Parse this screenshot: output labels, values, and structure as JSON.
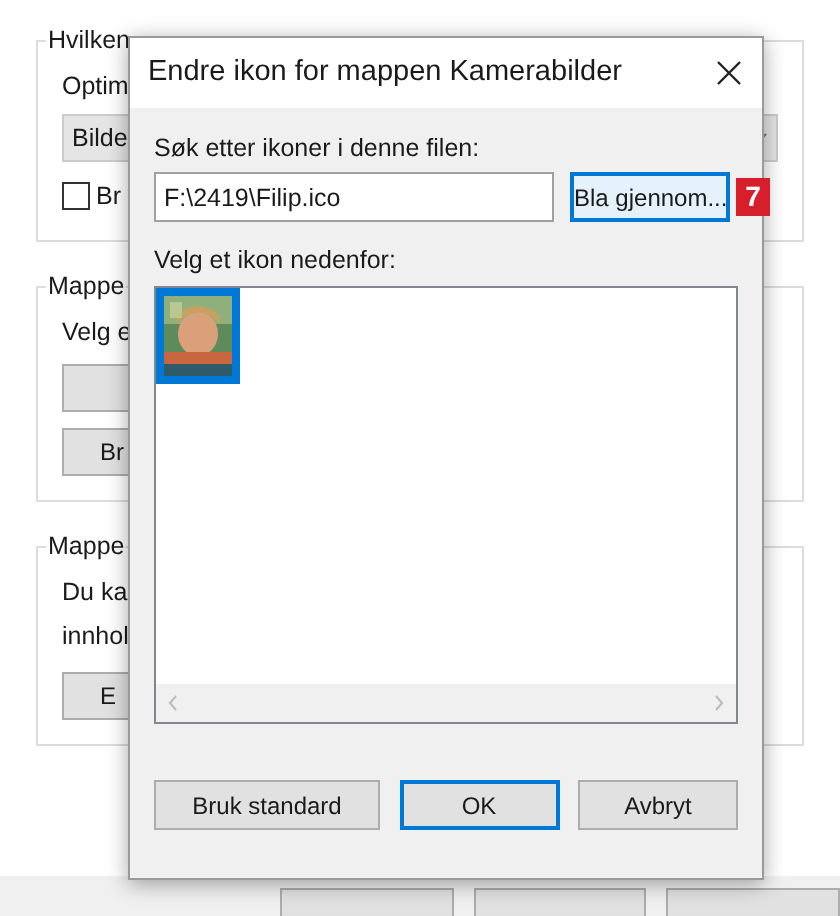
{
  "background": {
    "groups": [
      {
        "legend": "Hvilken",
        "lines": [
          "Optim"
        ],
        "dropdown": "Bilde",
        "checkbox": {
          "label": "Br",
          "checked": false
        }
      },
      {
        "legend": "Mappe",
        "lines": [
          "Velg e"
        ],
        "buttons": [
          {
            "kind": "blank"
          },
          {
            "kind": "text",
            "label": "Br"
          }
        ]
      },
      {
        "legend": "Mappe",
        "lines": [
          "Du ka",
          "innhol"
        ],
        "buttons": [
          {
            "kind": "text",
            "label": "E"
          }
        ]
      }
    ]
  },
  "dialog": {
    "title": "Endre ikon for mappen Kamerabilder",
    "file_label": "Søk etter ikoner i denne filen:",
    "file_value": "F:\\2419\\Filip.ico",
    "browse_button": "Bla gjennom...",
    "badge": "7",
    "list_label": "Velg et ikon nedenfor:",
    "icons": [
      {
        "kind": "picture",
        "selected": true
      }
    ],
    "buttons": [
      {
        "label": "Bruk standard",
        "default": false
      },
      {
        "label": "OK",
        "default": true
      },
      {
        "label": "Avbryt",
        "default": false
      }
    ]
  }
}
